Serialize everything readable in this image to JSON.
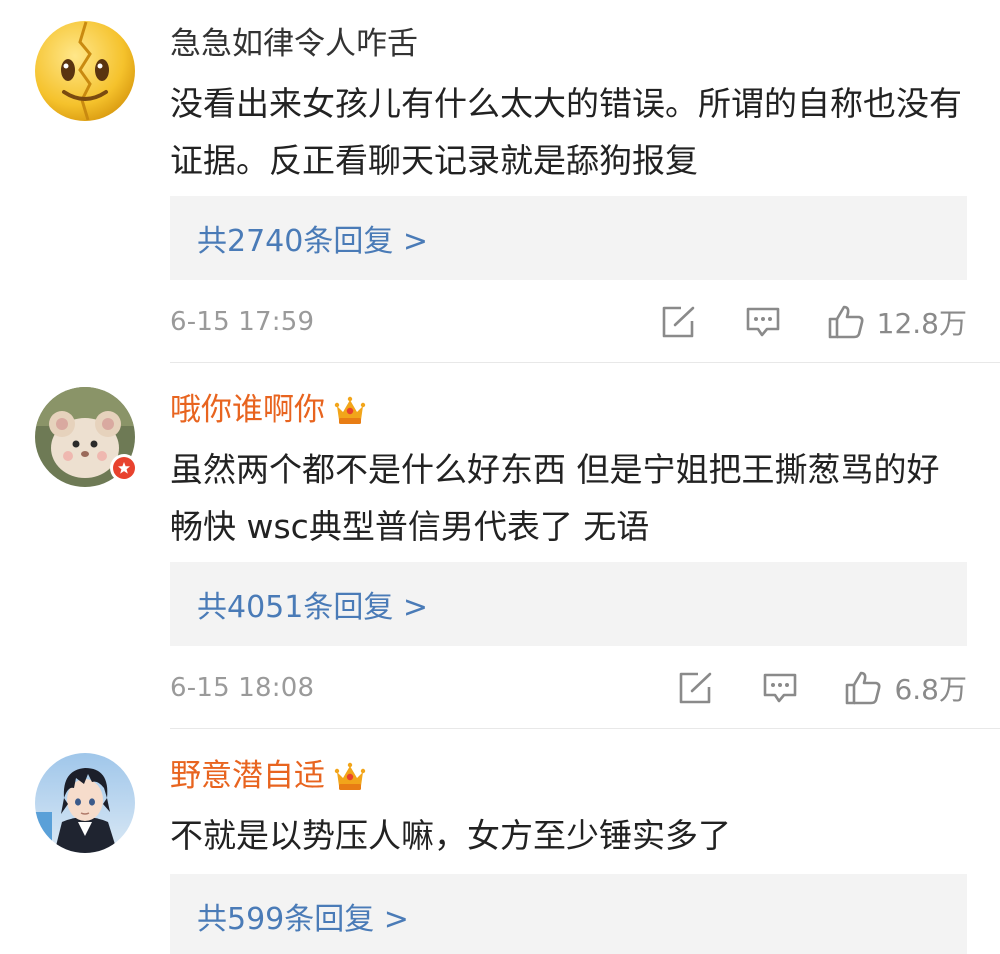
{
  "comments": [
    {
      "username": "急急如律令人咋舌",
      "vip": false,
      "text": "没看出来女孩儿有什么太大的错误。所谓的自称也没有证据。反正看聊天记录就是舔狗报复",
      "replies": "共2740条回复 >",
      "time": "6-15 17:59",
      "likes": "12.8万",
      "avatar": "emoji-face-avatar"
    },
    {
      "username": "哦你谁啊你",
      "vip": true,
      "text": "虽然两个都不是什么好东西 但是宁姐把王撕葱骂的好畅快 wsc典型普信男代表了 无语",
      "replies": "共4051条回复 >",
      "time": "6-15 18:08",
      "likes": "6.8万",
      "avatar": "plush-toy-avatar"
    },
    {
      "username": "野意潜自适",
      "vip": true,
      "text": "不就是以势压人嘛，女方至少锤实多了",
      "replies": "共599条回复 >",
      "avatar": "anime-boy-avatar"
    }
  ],
  "colors": {
    "vip_name": "#e8641f",
    "link": "#4a7bb7",
    "meta": "#9a9a9a",
    "reply_bg": "#f3f3f3"
  },
  "icons": [
    "share-icon",
    "comment-icon",
    "like-icon",
    "crown-icon",
    "verified-badge-icon"
  ]
}
